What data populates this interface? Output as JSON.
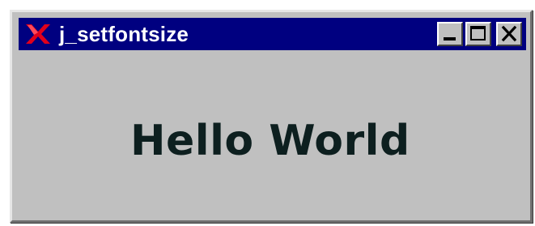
{
  "window": {
    "title": "j_setfontsize",
    "buttons": {
      "minimize_icon": "minimize-icon",
      "maximize_icon": "maximize-icon",
      "close_icon": "close-icon"
    }
  },
  "content": {
    "label_text": "Hello World"
  },
  "colors": {
    "titlebar": "#000080",
    "window_face": "#c0c0c0",
    "title_text": "#ffffff",
    "label_text": "#0d1f1f",
    "app_icon": "#e0001b"
  }
}
